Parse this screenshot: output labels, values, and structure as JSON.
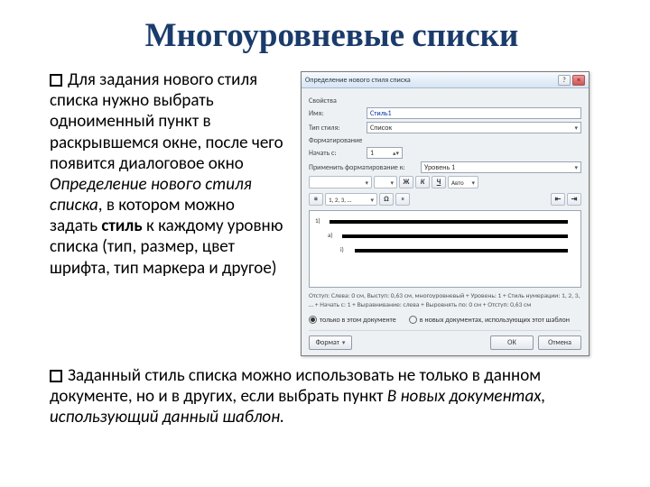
{
  "title": "Многоуровневые списки",
  "para1": {
    "pre": "Для задания нового стиля списка нужно выбрать одноименный пункт в раскрывшемся окне, после чего появится диалоговое окно ",
    "em": "Определение нового стиля списка",
    "mid1": ", в котором можно задать ",
    "b": "стиль",
    "post": " к каждому уровню списка (тип, размер, цвет шрифта, тип маркера и другое)"
  },
  "dialog": {
    "title": "Определение нового стиля списка",
    "section_props": "Свойства",
    "name_label": "Имя:",
    "name_value": "Стиль1",
    "type_label": "Тип стиля:",
    "type_value": "Список",
    "section_fmt": "Форматирование",
    "start_label": "Начать с:",
    "start_value": "1",
    "apply_label": "Применить форматирование к:",
    "apply_value": "Уровень 1",
    "font_value": "",
    "size_value": "",
    "b": "Ж",
    "i": "К",
    "u": "Ч",
    "numfmt": "1, 2, 3, …",
    "color": "Авто",
    "preview_labels": [
      "1)",
      "a)",
      "i)"
    ],
    "desc": "Отступ: Слева: 0 см, Выступ: 0,63 см, многоуровневый + Уровень: 1 + Стиль нумерации: 1, 2, 3, … + Начать с: 1 + Выравнивание: слева + Выровнять по: 0 см + Отступ: 0,63 см",
    "radio1": "только в этом документе",
    "radio2": "в новых документах, использующих этот шаблон",
    "format_btn": "Формат",
    "ok": "ОК",
    "cancel": "Отмена"
  },
  "para2": {
    "pre": "Заданный стиль списка можно использовать не только в данном документе, но и в других, если выбрать пункт ",
    "em": "В новых документах, использующий данный шаблон",
    "post": "."
  }
}
